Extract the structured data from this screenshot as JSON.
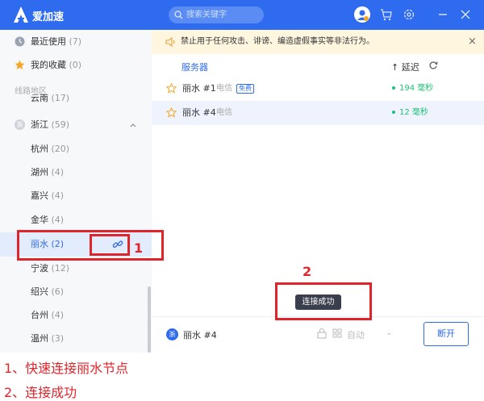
{
  "app": {
    "title": "爱加速"
  },
  "search": {
    "placeholder": "搜索关键字"
  },
  "sidebar": {
    "top_items": [
      {
        "label": "最近使用",
        "count": "(7)"
      },
      {
        "label": "我的收藏",
        "count": "(0)"
      }
    ],
    "section_label": "线路地区",
    "partial_item": {
      "label": "云南",
      "count": "(17)"
    },
    "province": {
      "badge": "浙",
      "label": "浙江",
      "count": "(59)"
    },
    "cities": [
      {
        "label": "杭州",
        "count": "(20)"
      },
      {
        "label": "湖州",
        "count": "(4)"
      },
      {
        "label": "嘉兴",
        "count": "(4)"
      },
      {
        "label": "金华",
        "count": "(4)"
      },
      {
        "label": "丽水",
        "count": "(2)"
      },
      {
        "label": "宁波",
        "count": "(12)"
      },
      {
        "label": "绍兴",
        "count": "(6)"
      },
      {
        "label": "台州",
        "count": "(4)"
      },
      {
        "label": "温州",
        "count": "(3)"
      }
    ]
  },
  "banner": {
    "text": "禁止用于任何攻击、诽谤、编造虚假事实等非法行为。"
  },
  "table": {
    "server_header": "服务器",
    "latency_header": "↑ 延迟",
    "rows": [
      {
        "name": "丽水 #1",
        "isp": "电信",
        "tag": "免费",
        "ping": "194 毫秒"
      },
      {
        "name": "丽水 #4",
        "isp": "电信",
        "tag": "",
        "ping": "12 毫秒"
      }
    ]
  },
  "toast": {
    "text": "连接成功"
  },
  "bottom": {
    "badge": "浙",
    "current_node": "丽水 #4",
    "mode_label": "自动",
    "disconnect_label": "断开"
  },
  "annotations": {
    "num1": "1",
    "num2": "2",
    "caption1": "1、快速连接丽水节点",
    "caption2": "2、连接成功"
  },
  "colors": {
    "accent": "#2f6bef",
    "ping": "#1fbf76",
    "annotation": "#e0242b",
    "banner_bg": "#fff6e0"
  }
}
